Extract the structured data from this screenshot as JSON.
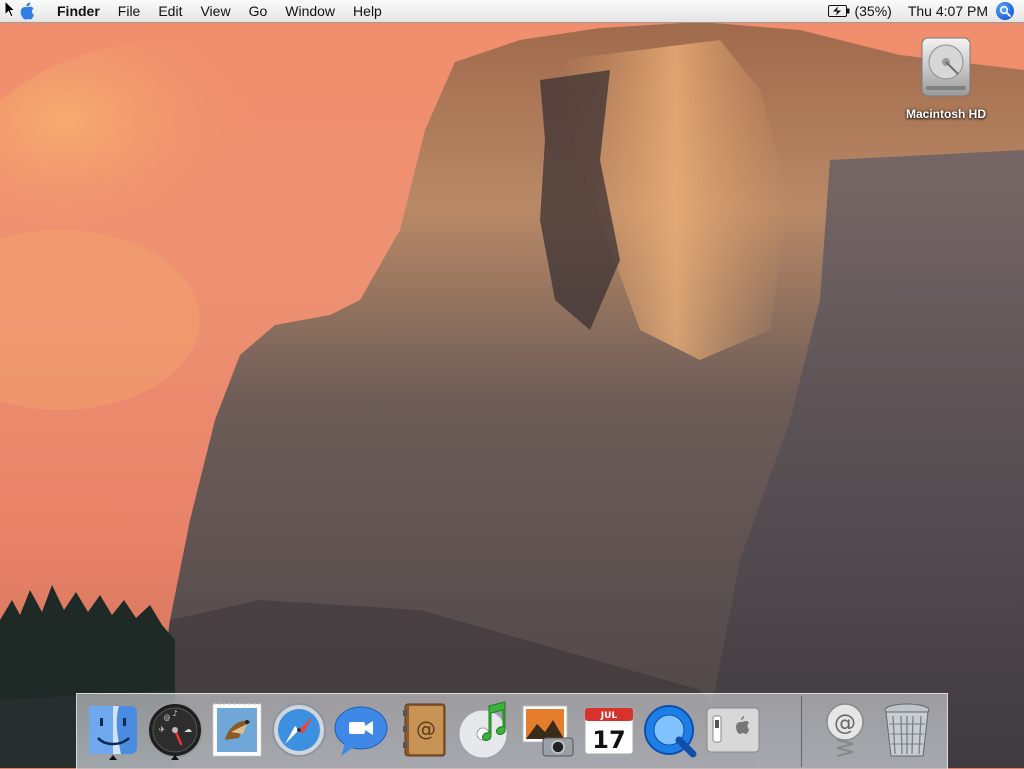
{
  "menubar": {
    "app_name": "Finder",
    "items": [
      "File",
      "Edit",
      "View",
      "Go",
      "Window",
      "Help"
    ],
    "battery_text": "(35%)",
    "clock": "Thu 4:07 PM",
    "apple_icon": "apple-logo-icon",
    "battery_icon": "battery-charging-icon",
    "spotlight_icon": "spotlight-search-icon"
  },
  "desktop": {
    "icons": [
      {
        "label": "Macintosh HD",
        "icon": "hard-drive-icon"
      }
    ]
  },
  "dock": {
    "apps": [
      {
        "name": "Finder",
        "icon": "finder-icon",
        "running": true
      },
      {
        "name": "Dashboard",
        "icon": "dashboard-icon",
        "running": true
      },
      {
        "name": "Mail",
        "icon": "mail-stamp-icon",
        "running": false
      },
      {
        "name": "Safari",
        "icon": "safari-compass-icon",
        "running": false
      },
      {
        "name": "iChat",
        "icon": "ichat-video-icon",
        "running": false
      },
      {
        "name": "Address Book",
        "icon": "address-book-icon",
        "running": false
      },
      {
        "name": "iTunes",
        "icon": "itunes-cd-icon",
        "running": false
      },
      {
        "name": "iPhoto",
        "icon": "iphoto-icon",
        "running": false
      },
      {
        "name": "iCal",
        "icon": "ical-calendar-icon",
        "running": false,
        "month": "JUL",
        "day": "17"
      },
      {
        "name": "QuickTime Player",
        "icon": "quicktime-icon",
        "running": false
      },
      {
        "name": "System Preferences",
        "icon": "system-preferences-switch-icon",
        "running": false
      },
      {
        "name": "Mail Accounts",
        "icon": "at-sign-spring-icon",
        "running": false
      },
      {
        "name": "Trash",
        "icon": "trash-icon",
        "running": false
      }
    ]
  },
  "colors": {
    "menubar_bg": "#f2f2f2",
    "sky": "#ec8c6e",
    "spotlight": "#1d5fd8"
  }
}
